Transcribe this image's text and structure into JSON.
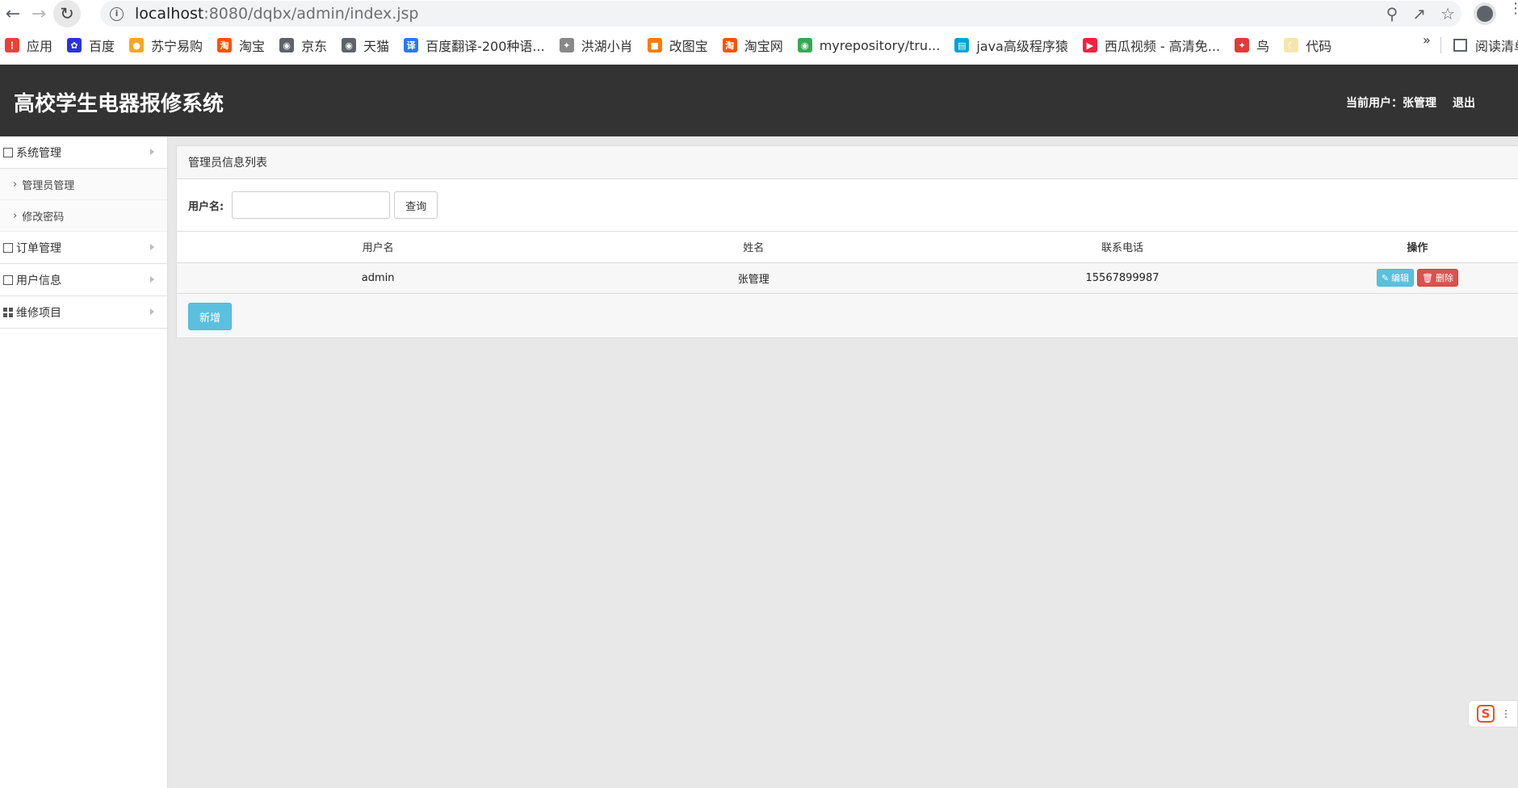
{
  "browser": {
    "url_host": "localhost",
    "url_rest": ":8080/dqbx/admin/index.jsp",
    "bookmarks": [
      {
        "label": "应用",
        "icon": "apps-grid-icon",
        "color": "#e94235"
      },
      {
        "label": "百度",
        "icon": "baidu-paw-icon",
        "color": "#2932e1"
      },
      {
        "label": "苏宁易购",
        "icon": "suning-lion-icon",
        "color": "#f5a623"
      },
      {
        "label": "淘宝",
        "icon": "taobao-icon",
        "color": "#ff5000"
      },
      {
        "label": "京东",
        "icon": "globe-icon",
        "color": "#5f6368"
      },
      {
        "label": "天猫",
        "icon": "globe-icon",
        "color": "#5f6368"
      },
      {
        "label": "百度翻译-200种语...",
        "icon": "translate-icon",
        "color": "#2a78f4"
      },
      {
        "label": "洪湖小肖",
        "icon": "bird-icon",
        "color": "#888888"
      },
      {
        "label": "改图宝",
        "icon": "gaitubao-icon",
        "color": "#ff7a00"
      },
      {
        "label": "淘宝网",
        "icon": "taobao-icon",
        "color": "#ff5000"
      },
      {
        "label": "myrepository/tru...",
        "icon": "chrome-icon",
        "color": "#34a853"
      },
      {
        "label": "java高级程序猿",
        "icon": "bilibili-icon",
        "color": "#00a1d6"
      },
      {
        "label": "西瓜视频 - 高清免...",
        "icon": "xigua-icon",
        "color": "#f2213f"
      },
      {
        "label": "鸟",
        "icon": "bird-red-icon",
        "color": "#e53935"
      },
      {
        "label": "代码",
        "icon": "moon-icon",
        "color": "#f5e6a8"
      }
    ],
    "overflow": "»",
    "reading_list": "阅读清单"
  },
  "header": {
    "title": "高校学生电器报修系统",
    "current_user": "当前用户：张管理",
    "logout": "退出"
  },
  "sidebar": {
    "groups": [
      {
        "label": "系统管理",
        "items": [
          "管理员管理",
          "修改密码"
        ]
      },
      {
        "label": "订单管理",
        "items": []
      },
      {
        "label": "用户信息",
        "items": []
      },
      {
        "label": "维修项目",
        "items": []
      }
    ]
  },
  "main": {
    "panel_title": "管理员信息列表",
    "search": {
      "label": "用户名:",
      "value": "",
      "button": "查询"
    },
    "table": {
      "headers": [
        "用户名",
        "姓名",
        "联系电话",
        "操作"
      ],
      "rows": [
        {
          "username": "admin",
          "name": "张管理",
          "phone": "15567899987"
        }
      ],
      "edit_label": "编辑",
      "delete_label": "删除"
    },
    "add_button": "新增"
  },
  "colors": {
    "header_bg": "#333333",
    "info": "#5bc0de",
    "danger": "#d9534f"
  }
}
